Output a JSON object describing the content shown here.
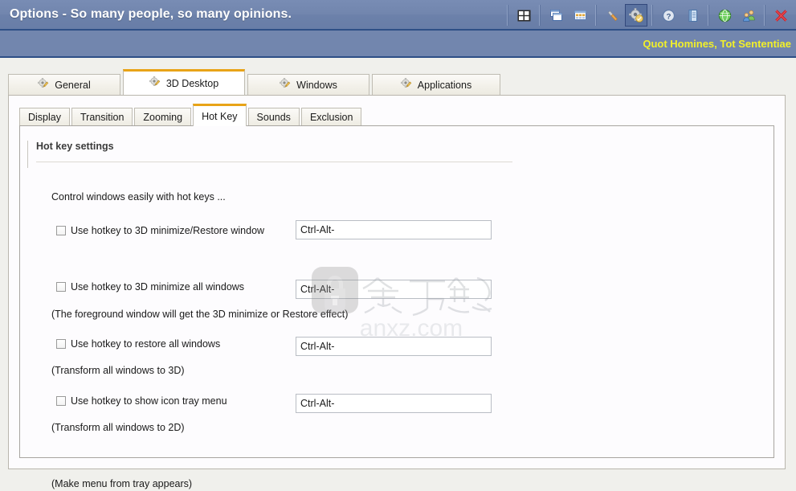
{
  "window": {
    "title": "Options - So many people, so many opinions.",
    "subtitle": "Quot Homines, Tot Sententiae",
    "titlebar_color": "#7286ae",
    "accent_color": "#e8a317",
    "subtitle_color": "#f2f029"
  },
  "toolbar": {
    "buttons": [
      {
        "name": "window-grid-icon",
        "tooltip": "Window Grid"
      },
      {
        "name": "cascade-windows-icon",
        "tooltip": "Cascade Windows"
      },
      {
        "name": "tile-windows-icon",
        "tooltip": "Tile Windows"
      },
      {
        "name": "tools-icon",
        "tooltip": "Tools"
      },
      {
        "name": "options-gear-icon",
        "tooltip": "Options",
        "selected": true
      },
      {
        "name": "help-icon",
        "tooltip": "Help"
      },
      {
        "name": "manual-book-icon",
        "tooltip": "Manual"
      },
      {
        "name": "globe-icon",
        "tooltip": "Website"
      },
      {
        "name": "people-icon",
        "tooltip": "Community"
      },
      {
        "name": "close-icon",
        "tooltip": "Close"
      }
    ]
  },
  "main_tabs": [
    {
      "label": "General",
      "active": false
    },
    {
      "label": "3D Desktop",
      "active": true
    },
    {
      "label": "Windows",
      "active": false
    },
    {
      "label": "Applications",
      "active": false
    }
  ],
  "sub_tabs": [
    {
      "label": "Display",
      "active": false
    },
    {
      "label": "Transition",
      "active": false
    },
    {
      "label": "Zooming",
      "active": false
    },
    {
      "label": "Hot Key",
      "active": true
    },
    {
      "label": "Sounds",
      "active": false
    },
    {
      "label": "Exclusion",
      "active": false
    }
  ],
  "panel": {
    "section_title": "Hot key settings",
    "intro": "Control windows easily with hot keys ...",
    "rows": [
      {
        "checkbox_label": "Use hotkey to 3D minimize/Restore window",
        "note": "(The foreground window will get the 3D minimize or Restore effect)",
        "input_value": "Ctrl-Alt-",
        "checked": false
      },
      {
        "checkbox_label": "Use hotkey to 3D minimize all windows",
        "note": "(Transform all windows to 3D)",
        "input_value": "Ctrl-Alt-",
        "checked": false
      },
      {
        "checkbox_label": "Use hotkey to restore all windows",
        "note": "(Transform all windows to 2D)",
        "input_value": "Ctrl-Alt-",
        "checked": false
      },
      {
        "checkbox_label": "Use hotkey to show icon tray menu",
        "note": "(Make menu from tray appears)",
        "input_value": "Ctrl-Alt-",
        "checked": false
      }
    ]
  },
  "watermark": {
    "text": "anxz.com",
    "cjk": "安下载"
  }
}
